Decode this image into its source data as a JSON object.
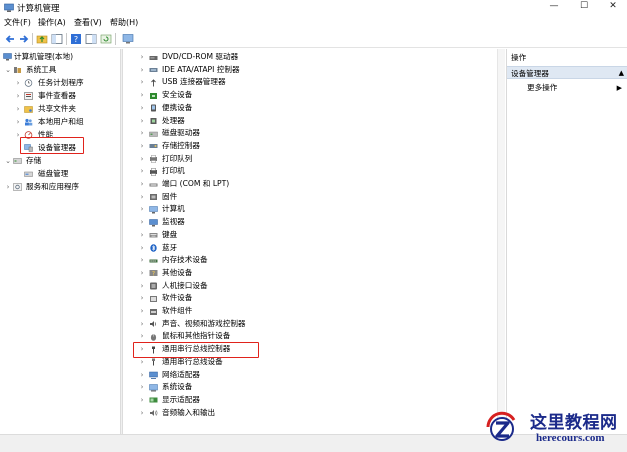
{
  "window": {
    "title": "计算机管理",
    "controls": {
      "minimize": "—",
      "maximize": "☐",
      "close": "✕"
    }
  },
  "menu": [
    "文件(F)",
    "操作(A)",
    "查看(V)",
    "帮助(H)"
  ],
  "left_tree": {
    "root": "计算机管理(本地)",
    "system_tools": "系统工具",
    "items": [
      {
        "label": "任务计划程序",
        "icon": "clock-icon"
      },
      {
        "label": "事件查看器",
        "icon": "event-viewer-icon"
      },
      {
        "label": "共享文件夹",
        "icon": "shared-folder-icon"
      },
      {
        "label": "本地用户和组",
        "icon": "users-icon"
      },
      {
        "label": "性能",
        "icon": "performance-icon"
      },
      {
        "label": "设备管理器",
        "icon": "device-manager-icon"
      }
    ],
    "storage": "存储",
    "disk_management": "磁盘管理",
    "services": "服务和应用程序"
  },
  "devices": [
    {
      "label": "DVD/CD-ROM 驱动器",
      "icon": "dvd-drive-icon"
    },
    {
      "label": "IDE ATA/ATAPI 控制器",
      "icon": "ide-controller-icon"
    },
    {
      "label": "USB 连接器管理器",
      "icon": "usb-connector-icon"
    },
    {
      "label": "安全设备",
      "icon": "security-device-icon"
    },
    {
      "label": "便携设备",
      "icon": "portable-device-icon"
    },
    {
      "label": "处理器",
      "icon": "processor-icon"
    },
    {
      "label": "磁盘驱动器",
      "icon": "disk-drive-icon"
    },
    {
      "label": "存储控制器",
      "icon": "storage-controller-icon"
    },
    {
      "label": "打印队列",
      "icon": "print-queue-icon"
    },
    {
      "label": "打印机",
      "icon": "printer-icon"
    },
    {
      "label": "端口 (COM 和 LPT)",
      "icon": "port-icon"
    },
    {
      "label": "固件",
      "icon": "firmware-icon"
    },
    {
      "label": "计算机",
      "icon": "computer-icon"
    },
    {
      "label": "监视器",
      "icon": "monitor-icon"
    },
    {
      "label": "键盘",
      "icon": "keyboard-icon"
    },
    {
      "label": "蓝牙",
      "icon": "bluetooth-icon"
    },
    {
      "label": "内存技术设备",
      "icon": "memory-device-icon"
    },
    {
      "label": "其他设备",
      "icon": "other-device-icon"
    },
    {
      "label": "人机接口设备",
      "icon": "hid-icon"
    },
    {
      "label": "软件设备",
      "icon": "software-device-icon"
    },
    {
      "label": "软件组件",
      "icon": "software-component-icon"
    },
    {
      "label": "声音、视频和游戏控制器",
      "icon": "sound-icon"
    },
    {
      "label": "鼠标和其他指针设备",
      "icon": "mouse-icon"
    },
    {
      "label": "通用串行总线控制器",
      "icon": "usb-controller-icon"
    },
    {
      "label": "通用串行总线设备",
      "icon": "usb-device-icon"
    },
    {
      "label": "网络适配器",
      "icon": "network-adapter-icon"
    },
    {
      "label": "系统设备",
      "icon": "system-device-icon"
    },
    {
      "label": "显示适配器",
      "icon": "display-adapter-icon"
    },
    {
      "label": "音频输入和输出",
      "icon": "audio-io-icon"
    }
  ],
  "actions": {
    "header": "操作",
    "selected": "设备管理器",
    "more": "更多操作"
  },
  "watermark": {
    "cn": "这里教程网",
    "en": "herecours.com"
  },
  "colors": {
    "highlight": "#e0231c",
    "selection": "#dfe8f3",
    "watermark": "#1b2a8a"
  }
}
